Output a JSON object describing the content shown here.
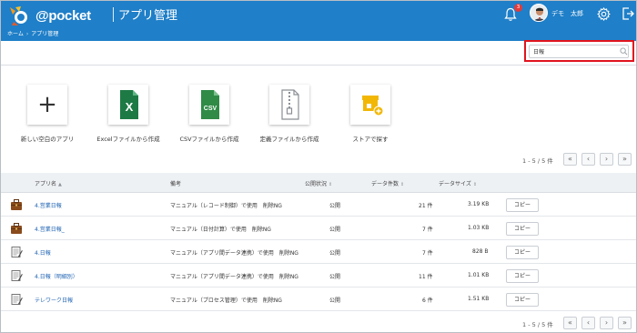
{
  "header": {
    "logo_text": "@pocket",
    "app_title": "アプリ管理",
    "breadcrumb": [
      "ホーム",
      "アプリ管理"
    ],
    "notification_count": "3",
    "user_name": "デモ　太郎"
  },
  "search": {
    "value": "日報",
    "icon": "search-icon"
  },
  "create_options": [
    {
      "label": "新しい空白のアプリ",
      "icon": "plus-icon"
    },
    {
      "label": "Excelファイルから作成",
      "icon": "excel-file-icon"
    },
    {
      "label": "CSVファイルから作成",
      "icon": "csv-file-icon"
    },
    {
      "label": "定義ファイルから作成",
      "icon": "zip-file-icon"
    },
    {
      "label": "ストアで探す",
      "icon": "store-icon"
    }
  ],
  "pager": {
    "count_text": "1 - 5 / 5 件",
    "first": "«",
    "prev": "‹",
    "next": "›",
    "last": "»"
  },
  "table": {
    "columns": [
      "アプリ名",
      "備考",
      "公開状況",
      "データ件数",
      "データサイズ"
    ],
    "rows": [
      {
        "icon": "briefcase-icon",
        "name": "4.営業日報",
        "note": "マニュアル（レコード制御）で使用　削除NG",
        "status": "公開",
        "count": "21 件",
        "size": "3.19 KB",
        "copy": "コピー"
      },
      {
        "icon": "briefcase-icon",
        "name": "4.営業日報_",
        "note": "マニュアル（日付計算）で使用　削除NG",
        "status": "公開",
        "count": "7 件",
        "size": "1.03 KB",
        "copy": "コピー"
      },
      {
        "icon": "notepad-icon",
        "name": "4.日報",
        "note": "マニュアル（アプリ間データ連携）で使用　削除NG",
        "status": "公開",
        "count": "7 件",
        "size": "828 B",
        "copy": "コピー"
      },
      {
        "icon": "notepad-icon",
        "name": "4.日報（明細別）",
        "note": "マニュアル（アプリ間データ連携）で使用　削除NG",
        "status": "公開",
        "count": "11 件",
        "size": "1.01 KB",
        "copy": "コピー"
      },
      {
        "icon": "notepad-icon",
        "name": "テレワーク日報",
        "note": "マニュアル（プロセス管理）で使用　削除NG",
        "status": "公開",
        "count": "6 件",
        "size": "1.51 KB",
        "copy": "コピー"
      }
    ]
  },
  "colors": {
    "header_bg": "#1f7fc8",
    "link": "#1f63b3",
    "highlight": "#e0141e",
    "excel": "#1e7a45",
    "csv": "#2f8b46",
    "store": "#f2b705"
  }
}
